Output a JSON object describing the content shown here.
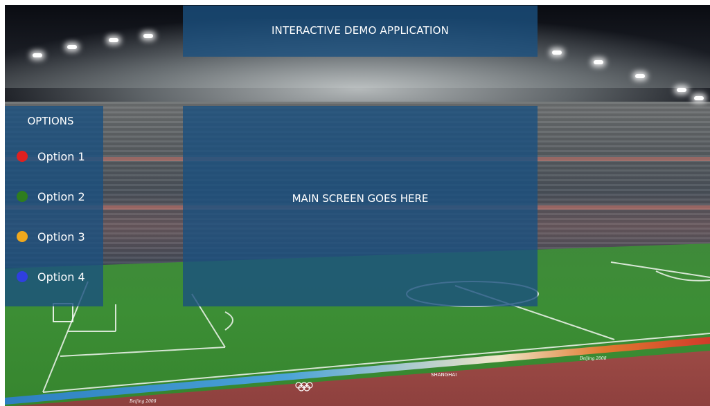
{
  "app": {
    "title": "INTERACTIVE DEMO APPLICATION"
  },
  "sidebar": {
    "heading": "OPTIONS",
    "items": [
      {
        "label": "Option 1",
        "color": "#e02020"
      },
      {
        "label": "Option 2",
        "color": "#2e7d1e"
      },
      {
        "label": "Option 3",
        "color": "#f0a81c"
      },
      {
        "label": "Option 4",
        "color": "#2f3fe0"
      }
    ]
  },
  "main": {
    "placeholder": "MAIN SCREEN GOES HERE"
  },
  "background": {
    "banner_texts": [
      "SHANGHAI",
      "Beijing 2008"
    ]
  }
}
